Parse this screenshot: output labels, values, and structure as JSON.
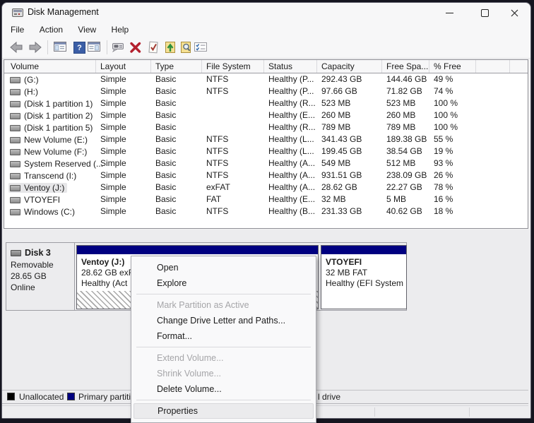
{
  "window": {
    "title": "Disk Management"
  },
  "menu_bar": {
    "items": [
      "File",
      "Action",
      "View",
      "Help"
    ]
  },
  "toolbar": {
    "help_glyph": "?",
    "icons": [
      "back-icon",
      "forward-icon",
      "console-tree-icon",
      "help-icon",
      "action-pane-icon",
      "popup-icon",
      "delete-icon",
      "check-document-icon",
      "folder-up-icon",
      "folder-search-icon",
      "checklist-icon"
    ]
  },
  "volume_table": {
    "columns": [
      "Volume",
      "Layout",
      "Type",
      "File System",
      "Status",
      "Capacity",
      "Free Spa...",
      "% Free"
    ],
    "rows": [
      {
        "volume": "(G:)",
        "layout": "Simple",
        "type": "Basic",
        "fs": "NTFS",
        "status": "Healthy (P...",
        "capacity": "292.43 GB",
        "free": "144.46 GB",
        "pct": "49 %",
        "selected": false
      },
      {
        "volume": "(H:)",
        "layout": "Simple",
        "type": "Basic",
        "fs": "NTFS",
        "status": "Healthy (P...",
        "capacity": "97.66 GB",
        "free": "71.82 GB",
        "pct": "74 %",
        "selected": false
      },
      {
        "volume": "(Disk 1 partition 1)",
        "layout": "Simple",
        "type": "Basic",
        "fs": "",
        "status": "Healthy (R...",
        "capacity": "523 MB",
        "free": "523 MB",
        "pct": "100 %",
        "selected": false
      },
      {
        "volume": "(Disk 1 partition 2)",
        "layout": "Simple",
        "type": "Basic",
        "fs": "",
        "status": "Healthy (E...",
        "capacity": "260 MB",
        "free": "260 MB",
        "pct": "100 %",
        "selected": false
      },
      {
        "volume": "(Disk 1 partition 5)",
        "layout": "Simple",
        "type": "Basic",
        "fs": "",
        "status": "Healthy (R...",
        "capacity": "789 MB",
        "free": "789 MB",
        "pct": "100 %",
        "selected": false
      },
      {
        "volume": "New Volume (E:)",
        "layout": "Simple",
        "type": "Basic",
        "fs": "NTFS",
        "status": "Healthy (L...",
        "capacity": "341.43 GB",
        "free": "189.38 GB",
        "pct": "55 %",
        "selected": false
      },
      {
        "volume": "New Volume (F:)",
        "layout": "Simple",
        "type": "Basic",
        "fs": "NTFS",
        "status": "Healthy (L...",
        "capacity": "199.45 GB",
        "free": "38.54 GB",
        "pct": "19 %",
        "selected": false
      },
      {
        "volume": "System Reserved (...",
        "layout": "Simple",
        "type": "Basic",
        "fs": "NTFS",
        "status": "Healthy (A...",
        "capacity": "549 MB",
        "free": "512 MB",
        "pct": "93 %",
        "selected": false
      },
      {
        "volume": "Transcend (I:)",
        "layout": "Simple",
        "type": "Basic",
        "fs": "NTFS",
        "status": "Healthy (A...",
        "capacity": "931.51 GB",
        "free": "238.09 GB",
        "pct": "26 %",
        "selected": false
      },
      {
        "volume": "Ventoy (J:)",
        "layout": "Simple",
        "type": "Basic",
        "fs": "exFAT",
        "status": "Healthy (A...",
        "capacity": "28.62 GB",
        "free": "22.27 GB",
        "pct": "78 %",
        "selected": true
      },
      {
        "volume": "VTOYEFI",
        "layout": "Simple",
        "type": "Basic",
        "fs": "FAT",
        "status": "Healthy (E...",
        "capacity": "32 MB",
        "free": "5 MB",
        "pct": "16 %",
        "selected": false
      },
      {
        "volume": "Windows (C:)",
        "layout": "Simple",
        "type": "Basic",
        "fs": "NTFS",
        "status": "Healthy (B...",
        "capacity": "231.33 GB",
        "free": "40.62 GB",
        "pct": "18 %",
        "selected": false
      }
    ]
  },
  "disk_panel": {
    "name": "Disk 3",
    "media": "Removable",
    "capacity": "28.65 GB",
    "status": "Online"
  },
  "disk_partitions": {
    "ventoy": {
      "title": "Ventoy  (J:)",
      "info": "28.62 GB exF",
      "status": "Healthy (Act"
    },
    "vtoyefi": {
      "title": "VTOYEFI",
      "info": "32 MB FAT",
      "status": "Healthy (EFI System"
    }
  },
  "context_menu": {
    "items": [
      {
        "label": "Open",
        "enabled": true
      },
      {
        "label": "Explore",
        "enabled": true
      },
      {
        "label": "Mark Partition as Active",
        "enabled": false
      },
      {
        "label": "Change Drive Letter and Paths...",
        "enabled": true
      },
      {
        "label": "Format...",
        "enabled": true
      },
      {
        "label": "Extend Volume...",
        "enabled": false
      },
      {
        "label": "Shrink Volume...",
        "enabled": false
      },
      {
        "label": "Delete Volume...",
        "enabled": true
      },
      {
        "label": "Properties",
        "enabled": true,
        "highlighted": true
      }
    ]
  },
  "legend": {
    "items": [
      {
        "label": "Unallocated",
        "color": "#000000"
      },
      {
        "label": "Primary partition",
        "color": "#000080"
      }
    ],
    "partial_label": "l drive"
  },
  "colors": {
    "primary_partition_band": "#000080",
    "unallocated_swatch": "#000000",
    "delete_x": "#b3202e",
    "folder_yellow": "#f5e092",
    "help_blue": "#3b5ea6",
    "window_bg": "#f1f1f2",
    "pane_bg": "#ececee"
  }
}
